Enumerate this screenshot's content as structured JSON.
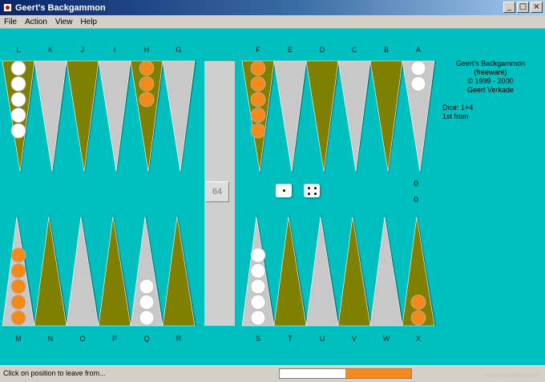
{
  "window": {
    "title": "Geert's Backgammon",
    "buttons": {
      "minimize": "_",
      "maximize": "□",
      "close": "×"
    }
  },
  "menu": [
    {
      "label": "File"
    },
    {
      "label": "Action"
    },
    {
      "label": "View"
    },
    {
      "label": "Help"
    }
  ],
  "board": {
    "colors": {
      "background": "#00bfbf",
      "point_dark": "#7f7f00",
      "point_light": "#c8c8c8",
      "bar": "#cfcfcf",
      "checker_orange": "#f48a1c",
      "checker_white": "#ffffff"
    },
    "top_labels": [
      "L",
      "K",
      "J",
      "I",
      "H",
      "G",
      "F",
      "E",
      "D",
      "C",
      "B",
      "A"
    ],
    "bottom_labels": [
      "M",
      "N",
      "O",
      "P",
      "Q",
      "R",
      "S",
      "T",
      "U",
      "V",
      "W",
      "X"
    ],
    "top_points": [
      {
        "label": "L",
        "color": "dark",
        "checkers": "white",
        "count": 5
      },
      {
        "label": "K",
        "color": "light",
        "checkers": null,
        "count": 0
      },
      {
        "label": "J",
        "color": "dark",
        "checkers": null,
        "count": 0
      },
      {
        "label": "I",
        "color": "light",
        "checkers": null,
        "count": 0
      },
      {
        "label": "H",
        "color": "dark",
        "checkers": "orange",
        "count": 3
      },
      {
        "label": "G",
        "color": "light",
        "checkers": null,
        "count": 0
      },
      {
        "label": "F",
        "color": "dark",
        "checkers": "orange",
        "count": 5
      },
      {
        "label": "E",
        "color": "light",
        "checkers": null,
        "count": 0
      },
      {
        "label": "D",
        "color": "dark",
        "checkers": null,
        "count": 0
      },
      {
        "label": "C",
        "color": "light",
        "checkers": null,
        "count": 0
      },
      {
        "label": "B",
        "color": "dark",
        "checkers": null,
        "count": 0
      },
      {
        "label": "A",
        "color": "light",
        "checkers": "white",
        "count": 2
      }
    ],
    "bottom_points": [
      {
        "label": "M",
        "color": "light",
        "checkers": "orange",
        "count": 5
      },
      {
        "label": "N",
        "color": "dark",
        "checkers": null,
        "count": 0
      },
      {
        "label": "O",
        "color": "light",
        "checkers": null,
        "count": 0
      },
      {
        "label": "P",
        "color": "dark",
        "checkers": null,
        "count": 0
      },
      {
        "label": "Q",
        "color": "light",
        "checkers": "white",
        "count": 3
      },
      {
        "label": "R",
        "color": "dark",
        "checkers": null,
        "count": 0
      },
      {
        "label": "S",
        "color": "light",
        "checkers": "white",
        "count": 5
      },
      {
        "label": "T",
        "color": "dark",
        "checkers": null,
        "count": 0
      },
      {
        "label": "U",
        "color": "light",
        "checkers": null,
        "count": 0
      },
      {
        "label": "V",
        "color": "dark",
        "checkers": null,
        "count": 0
      },
      {
        "label": "W",
        "color": "light",
        "checkers": null,
        "count": 0
      },
      {
        "label": "X",
        "color": "dark",
        "checkers": "orange",
        "count": 2
      }
    ],
    "doubling_cube": "64",
    "dice": [
      1,
      4
    ],
    "scores": [
      "0",
      "0"
    ]
  },
  "info": {
    "line1": "Geert's Backgammon",
    "line2": "(freeware)",
    "line3": "© 1999 - 2000",
    "line4": "Geert Verkade",
    "dice": "Dice: 1+4",
    "move": "1st from"
  },
  "status": {
    "text": "Click on position to leave from...",
    "progress": {
      "white_fraction": 0.5,
      "orange_fraction": 0.5
    },
    "watermark": "www.softpedia.com"
  }
}
